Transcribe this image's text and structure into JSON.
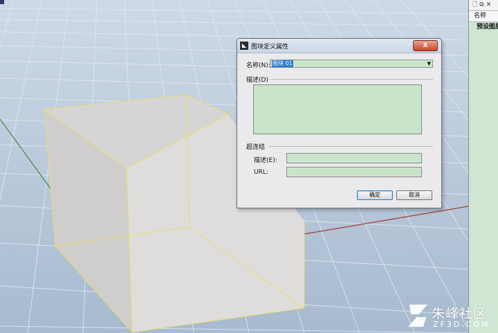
{
  "dialog": {
    "title": "图块定义属性",
    "close_label": "X",
    "name_label": "名称(N):",
    "name_value": "图块 01",
    "description_label": "描述(D)",
    "hyperlink_label": "超连结",
    "link_desc_label": "描述(E):",
    "url_label": "URL:",
    "ok_label": "确定",
    "cancel_label": "取消"
  },
  "panel": {
    "header": "名称",
    "item": "预设图层"
  },
  "watermark": {
    "main": "朱峰社区",
    "sub": "ZF3D.COM"
  },
  "colors": {
    "field_fill": "#c8e5cc",
    "box_edge": "#e8dc6a",
    "x_axis": "#a33a2e",
    "y_axis": "#3f8a3f"
  }
}
